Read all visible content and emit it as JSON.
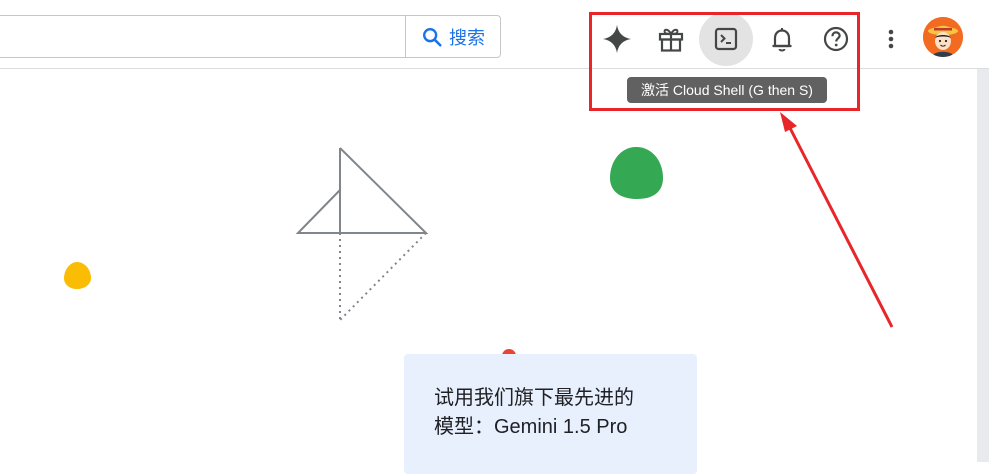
{
  "search": {
    "value": "",
    "placeholder": "",
    "button_label": "搜索"
  },
  "toolbar": {
    "buttons": [
      {
        "name": "gemini-icon",
        "active": false
      },
      {
        "name": "gift-icon",
        "active": false
      },
      {
        "name": "cloud-shell-icon",
        "active": true
      },
      {
        "name": "bell-icon",
        "active": false
      },
      {
        "name": "help-icon",
        "active": false
      },
      {
        "name": "more-vert-icon",
        "active": false
      }
    ],
    "tooltip": "激活 Cloud Shell (G then S)"
  },
  "promo": {
    "line1": "试用我们旗下最先进的",
    "line2": "模型：Gemini 1.5 Pro"
  },
  "colors": {
    "accent": "#1a73e8",
    "icon": "#444746",
    "tooltip_bg": "#616161",
    "annotation_red": "#e8262a",
    "green": "#34a853",
    "yellow": "#fbbc04",
    "red_dot": "#ea4335",
    "promo_bg": "#e8f0fe",
    "shape_stroke": "#80868b"
  }
}
